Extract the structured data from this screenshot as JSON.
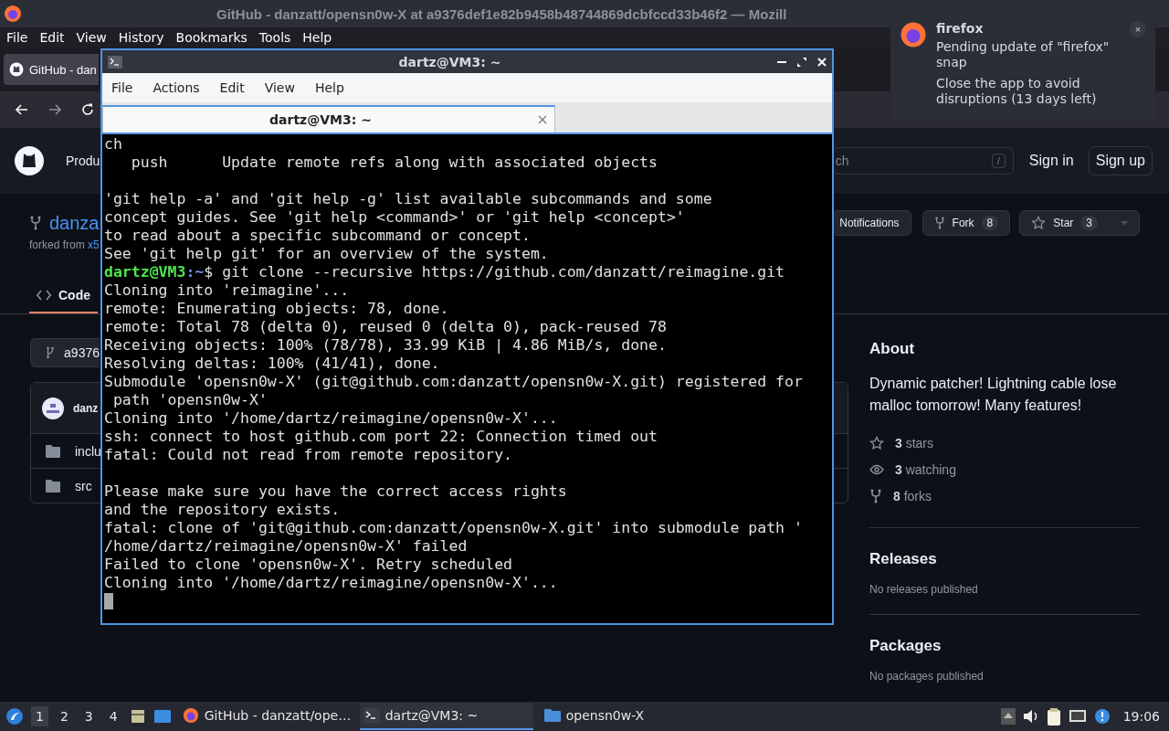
{
  "browser": {
    "title": "GitHub - danzatt/opensn0w-X at a9376def1e82b9458b48744869dcbfccd33b46f2 — Mozill",
    "menu": [
      "File",
      "Edit",
      "View",
      "History",
      "Bookmarks",
      "Tools",
      "Help"
    ],
    "tab": {
      "title": "GitHub - dan",
      "selected": true
    },
    "github": {
      "nav_item": "Produ",
      "search": {
        "placeholder": "ch",
        "key": "/"
      },
      "sign_in": "Sign in",
      "sign_up": "Sign up",
      "repo_name": "danza",
      "forked_from": "forked from",
      "forked_link": "x5",
      "notifications": "Notifications",
      "fork": {
        "label": "Fork",
        "count": "8"
      },
      "star": {
        "label": "Star",
        "count": "3"
      },
      "tabs": [
        {
          "label": "Code",
          "selected": true
        }
      ],
      "branch": "a9376",
      "commit_author": "danz",
      "files": [
        {
          "kind": "folder",
          "name": "inclu"
        },
        {
          "kind": "folder",
          "name": "src"
        }
      ],
      "about": {
        "heading": "About",
        "description": "Dynamic patcher! Lightning cable lose malloc tomorrow! Many features!",
        "stats": [
          {
            "kind": "star",
            "text": "**3** stars"
          },
          {
            "kind": "eye",
            "text": "**3** watching"
          },
          {
            "kind": "fork",
            "text": "**8** forks"
          }
        ]
      },
      "releases": {
        "heading": "Releases",
        "note": "No releases published"
      },
      "packages": {
        "heading": "Packages",
        "note": "No packages published"
      }
    }
  },
  "terminal": {
    "title": "dartz@VM3: ~",
    "menu": [
      "File",
      "Actions",
      "Edit",
      "View",
      "Help"
    ],
    "tab": {
      "title": "dartz@VM3: ~",
      "selected": true
    },
    "lines": [
      {
        "kind": "text",
        "text": "ch"
      },
      {
        "kind": "text",
        "text": "   push      Update remote refs along with associated objects"
      },
      {
        "kind": "blank"
      },
      {
        "kind": "text",
        "text": "'git help -a' and 'git help -g' list available subcommands and some"
      },
      {
        "kind": "text",
        "text": "concept guides. See 'git help <command>' or 'git help <concept>'"
      },
      {
        "kind": "text",
        "text": "to read about a specific subcommand or concept."
      },
      {
        "kind": "text",
        "text": "See 'git help git' for an overview of the system."
      },
      {
        "kind": "prompt",
        "user": "dartz@VM3",
        "path": ":~",
        "text": "$ git clone --recursive https://github.com/danzatt/reimagine.git"
      },
      {
        "kind": "text",
        "text": "Cloning into 'reimagine'..."
      },
      {
        "kind": "text",
        "text": "remote: Enumerating objects: 78, done."
      },
      {
        "kind": "text",
        "text": "remote: Total 78 (delta 0), reused 0 (delta 0), pack-reused 78"
      },
      {
        "kind": "text",
        "text": "Receiving objects: 100% (78/78), 33.99 KiB | 4.86 MiB/s, done."
      },
      {
        "kind": "text",
        "text": "Resolving deltas: 100% (41/41), done."
      },
      {
        "kind": "text",
        "text": "Submodule 'opensn0w-X' (git@github.com:danzatt/opensn0w-X.git) registered for"
      },
      {
        "kind": "text",
        "text": " path 'opensn0w-X'"
      },
      {
        "kind": "text",
        "text": "Cloning into '/home/dartz/reimagine/opensn0w-X'..."
      },
      {
        "kind": "text",
        "text": "ssh: connect to host github.com port 22: Connection timed out"
      },
      {
        "kind": "text",
        "text": "fatal: Could not read from remote repository."
      },
      {
        "kind": "blank"
      },
      {
        "kind": "text",
        "text": "Please make sure you have the correct access rights"
      },
      {
        "kind": "text",
        "text": "and the repository exists."
      },
      {
        "kind": "text",
        "text": "fatal: clone of 'git@github.com:danzatt/opensn0w-X.git' into submodule path '"
      },
      {
        "kind": "text",
        "text": "/home/dartz/reimagine/opensn0w-X' failed"
      },
      {
        "kind": "text",
        "text": "Failed to clone 'opensn0w-X'. Retry scheduled"
      },
      {
        "kind": "text",
        "text": "Cloning into '/home/dartz/reimagine/opensn0w-X'..."
      },
      {
        "kind": "cursor"
      }
    ]
  },
  "notification": {
    "app": "firefox",
    "summary": "Pending update of \"firefox\" snap",
    "body": "Close the app to avoid disruptions (13 days left)",
    "close": "×"
  },
  "taskbar": {
    "workspaces": [
      {
        "label": "1",
        "selected": true
      },
      {
        "label": "2",
        "selected": false
      },
      {
        "label": "3",
        "selected": false
      },
      {
        "label": "4",
        "selected": false
      }
    ],
    "tasks": [
      {
        "kind": "browser",
        "title": "GitHub - danzatt/ope…",
        "selected": false
      },
      {
        "kind": "terminal",
        "title": "dartz@VM3: ~",
        "selected": true
      },
      {
        "kind": "folder",
        "title": "opensn0w-X",
        "selected": false
      }
    ],
    "clock": "19:06"
  }
}
